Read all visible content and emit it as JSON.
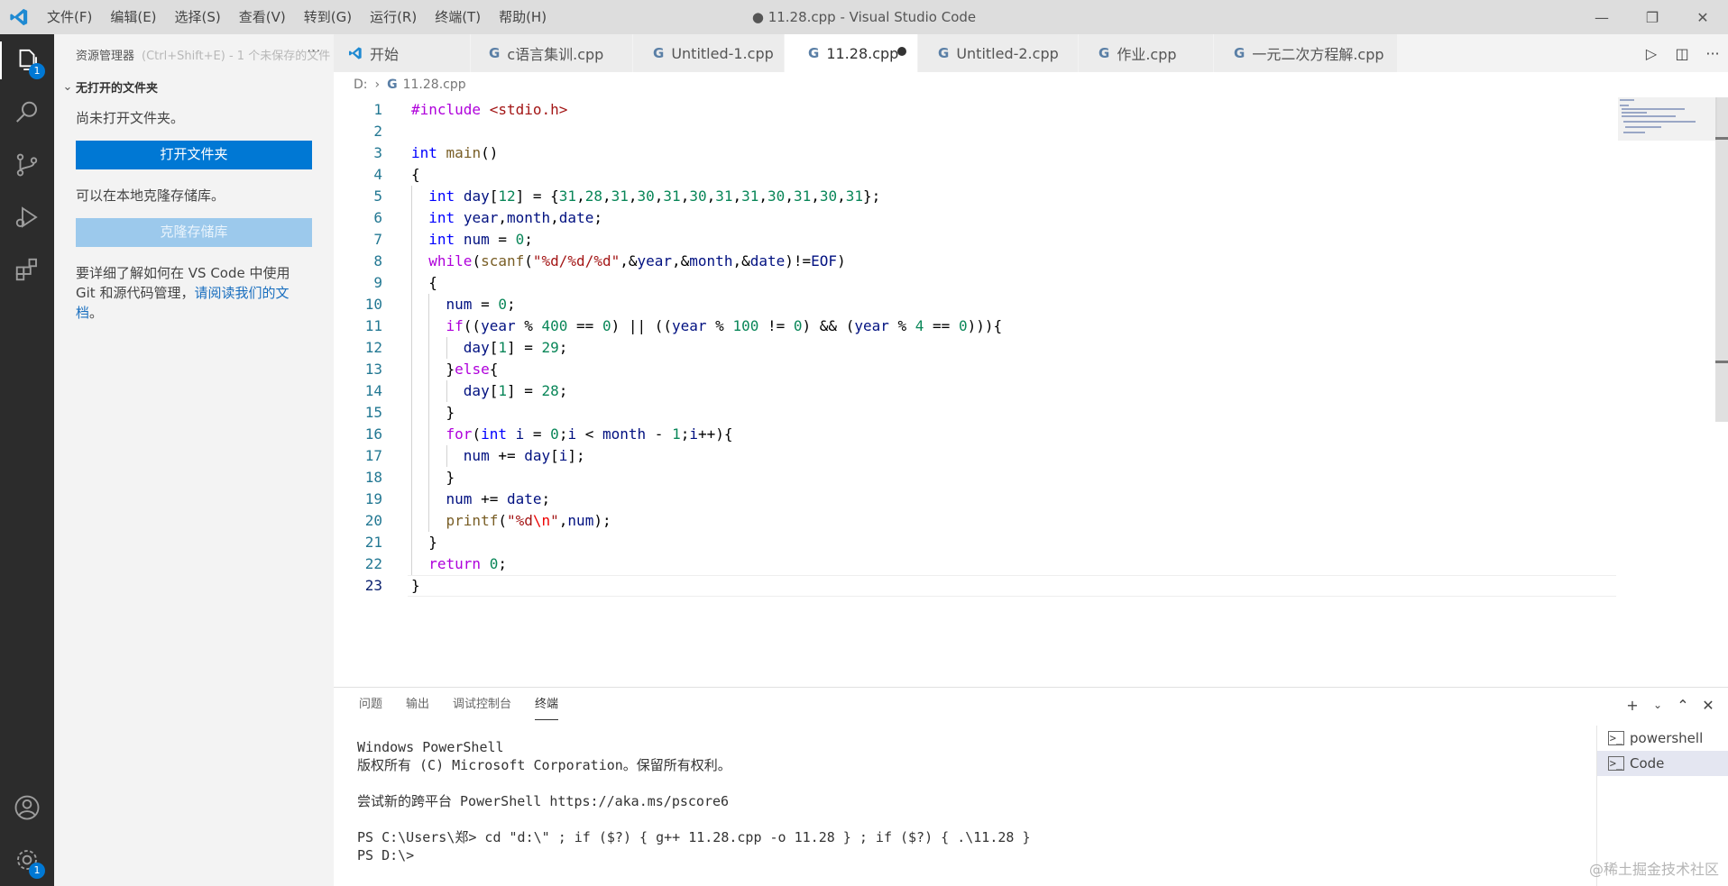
{
  "titlebar": {
    "menu": [
      "文件(F)",
      "编辑(E)",
      "选择(S)",
      "查看(V)",
      "转到(G)",
      "运行(R)",
      "终端(T)",
      "帮助(H)"
    ],
    "title": "● 11.28.cpp - Visual Studio Code"
  },
  "activity": {
    "explorer_badge": "1",
    "settings_badge": "1"
  },
  "sidebar": {
    "header": "资源管理器",
    "header_hint": "(Ctrl+Shift+E) - 1 个未保存的文件",
    "section": "无打开的文件夹",
    "no_folder_text": "尚未打开文件夹。",
    "open_folder_button": "打开文件夹",
    "clone_text": "可以在本地克隆存储库。",
    "clone_button": "克隆存储库",
    "git_text": "要详细了解如何在 VS Code 中使用 Git 和源代码管理，",
    "git_link": "请阅读我们的文档",
    "git_suffix": "。"
  },
  "tabs": [
    {
      "label": "开始",
      "icon": "vscode-logo-icon",
      "active": false
    },
    {
      "label": "c语言集训.cpp",
      "icon": "cpp-icon",
      "active": false
    },
    {
      "label": "Untitled-1.cpp",
      "icon": "cpp-icon",
      "active": false
    },
    {
      "label": "11.28.cpp",
      "icon": "cpp-icon",
      "active": true,
      "dirty": true
    },
    {
      "label": "Untitled-2.cpp",
      "icon": "cpp-icon",
      "active": false
    },
    {
      "label": "作业.cpp",
      "icon": "cpp-icon",
      "active": false
    },
    {
      "label": "一元二次方程解.cpp",
      "icon": "cpp-icon",
      "active": false
    }
  ],
  "breadcrumb": {
    "drive": "D:",
    "file": "11.28.cpp"
  },
  "editor": {
    "current_line": 23,
    "lines": [
      "#include <stdio.h>",
      "",
      "int main()",
      "{",
      "  int day[12] = {31,28,31,30,31,30,31,31,30,31,30,31};",
      "  int year,month,date;",
      "  int num = 0;",
      "  while(scanf(\"%d/%d/%d\",&year,&month,&date)!=EOF)",
      "  {",
      "    num = 0;",
      "    if((year % 400 == 0) || ((year % 100 != 0) && (year % 4 == 0))){",
      "      day[1] = 29;",
      "    }else{",
      "      day[1] = 28;",
      "    }",
      "    for(int i = 0;i < month - 1;i++){",
      "      num += day[i];",
      "    }",
      "    num += date;",
      "    printf(\"%d\\n\",num);",
      "  }",
      "  return 0;",
      "}"
    ]
  },
  "panel": {
    "tabs": [
      "问题",
      "输出",
      "调试控制台",
      "终端"
    ],
    "active_tab": "终端",
    "terminal_lines": [
      "Windows PowerShell",
      "版权所有 (C) Microsoft Corporation。保留所有权利。",
      "",
      "尝试新的跨平台 PowerShell https://aka.ms/pscore6",
      "",
      "PS C:\\Users\\郑> cd \"d:\\\" ; if ($?) { g++ 11.28.cpp -o 11.28 } ; if ($?) { .\\11.28 }",
      "PS D:\\>"
    ],
    "terminals": [
      "powershell",
      "Code"
    ],
    "active_terminal": "Code"
  },
  "watermark": "@稀土掘金技术社区",
  "colors": {
    "accent": "#0078d4",
    "activity_bg": "#2c2c2c",
    "sidebar_bg": "#f3f3f3"
  }
}
